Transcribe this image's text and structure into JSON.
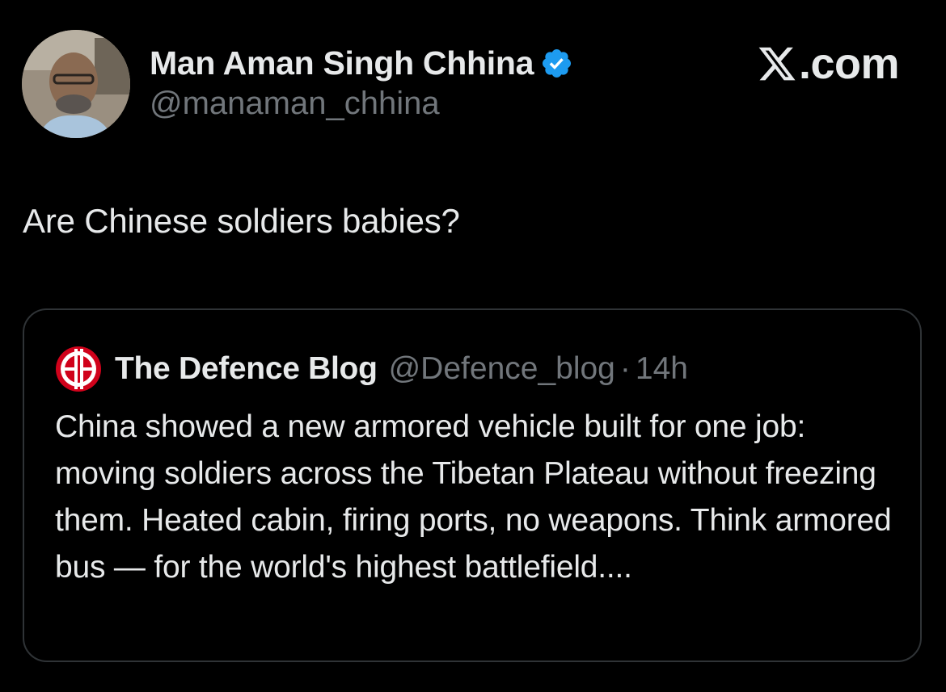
{
  "author": {
    "display_name": "Man Aman Singh Chhina",
    "handle": "@manaman_chhina",
    "verified": true
  },
  "brand": {
    "label": ".com",
    "icon": "x-logo-icon"
  },
  "tweet": {
    "text": "Are Chinese soldiers babies?"
  },
  "quoted_tweet": {
    "display_name": "The Defence Blog",
    "handle": "@Defence_blog",
    "separator": "·",
    "time": "14h",
    "icon": "defence-blog-logo-icon",
    "text": "China showed a new armored vehicle built for one job: moving soldiers across the Tibetan Plateau without freezing them. Heated cabin, firing ports, no weapons. Think armored bus — for the world's highest battlefield...."
  },
  "colors": {
    "background": "#000000",
    "primary_text": "#e7e9ea",
    "secondary_text": "#71767b",
    "verified_blue": "#1d9bf0",
    "border": "#2f3336",
    "defence_blog_red": "#d0021b"
  }
}
